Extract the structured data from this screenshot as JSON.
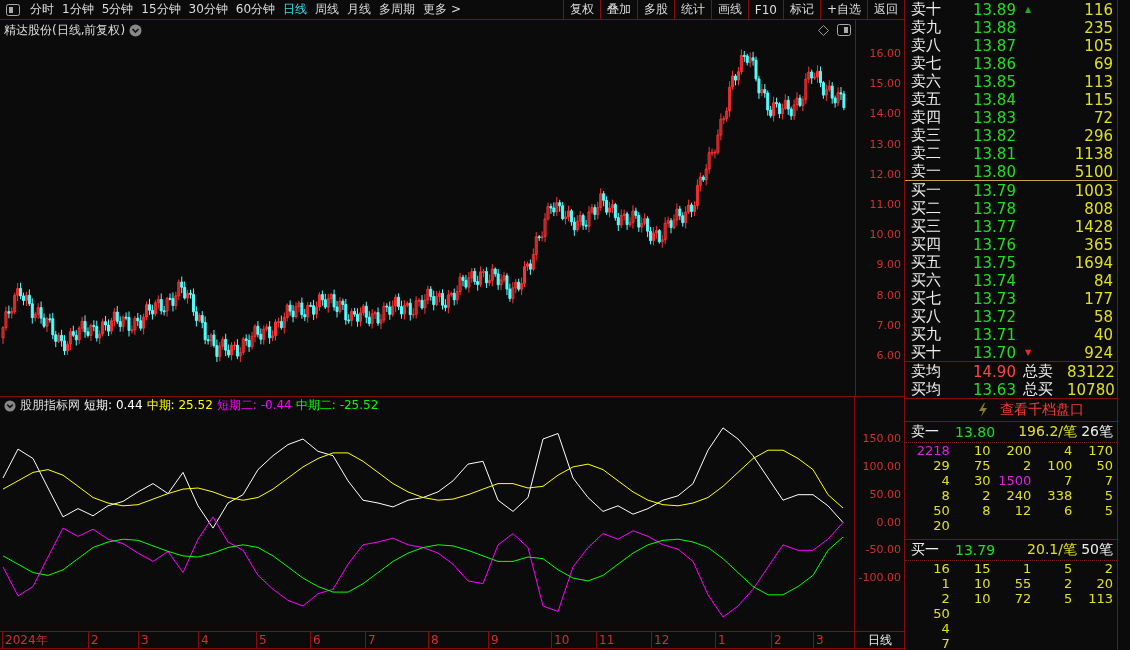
{
  "toolbar": {
    "periods": [
      {
        "label": "分时",
        "selected": false
      },
      {
        "label": "1分钟",
        "selected": false
      },
      {
        "label": "5分钟",
        "selected": false
      },
      {
        "label": "15分钟",
        "selected": false
      },
      {
        "label": "30分钟",
        "selected": false
      },
      {
        "label": "60分钟",
        "selected": false
      },
      {
        "label": "日线",
        "selected": true
      },
      {
        "label": "周线",
        "selected": false
      },
      {
        "label": "月线",
        "selected": false
      },
      {
        "label": "多周期",
        "selected": false
      },
      {
        "label": "更多 >",
        "selected": false
      }
    ],
    "actions": [
      "复权",
      "叠加",
      "多股",
      "统计",
      "画线",
      "F10",
      "标记",
      "+自选",
      "返回"
    ]
  },
  "main_chart": {
    "title": "精达股份(日线,前复权)",
    "price_ticks": [
      "16.00",
      "15.00",
      "14.00",
      "13.00",
      "12.00",
      "11.00",
      "10.00",
      "9.00",
      "8.00",
      "7.00",
      "6.00"
    ]
  },
  "indicator": {
    "name": "股朋指标网",
    "readouts": [
      {
        "label": "短期:",
        "value": "0.44",
        "color": "#ffffff"
      },
      {
        "label": "中期:",
        "value": "25.52",
        "color": "#ffff00"
      },
      {
        "label": "短期二:",
        "value": "-0.44",
        "color": "#ff00ff"
      },
      {
        "label": "中期二:",
        "value": "-25.52",
        "color": "#00ff00"
      }
    ],
    "chart_data": {
      "type": "line",
      "ylim": [
        -195,
        195
      ],
      "yticks": [
        {
          "value": 150,
          "label": "150.00"
        },
        {
          "value": 100,
          "label": "100.00"
        },
        {
          "value": 50,
          "label": "50.00"
        },
        {
          "value": 0,
          "label": "0.00"
        },
        {
          "value": -50,
          "label": "-50.00"
        },
        {
          "value": -100,
          "label": "-100.00"
        }
      ],
      "series": [
        {
          "color": "#ffffff",
          "values": [
            80,
            132,
            115,
            62,
            10,
            25,
            12,
            30,
            38,
            55,
            70,
            52,
            90,
            30,
            -10,
            35,
            50,
            95,
            120,
            140,
            150,
            128,
            120,
            75,
            40,
            35,
            28,
            40,
            45,
            55,
            75,
            105,
            110,
            40,
            20,
            45,
            150,
            160,
            80,
            45,
            20,
            30,
            15,
            25,
            40,
            48,
            70,
            130,
            170,
            150,
            120,
            80,
            40,
            50,
            50,
            30,
            0
          ]
        },
        {
          "color": "#ffff00",
          "values": [
            60,
            75,
            90,
            95,
            85,
            65,
            45,
            35,
            30,
            32,
            42,
            52,
            60,
            62,
            55,
            45,
            40,
            45,
            60,
            80,
            100,
            115,
            125,
            125,
            110,
            90,
            70,
            55,
            45,
            40,
            42,
            50,
            60,
            70,
            70,
            62,
            65,
            85,
            100,
            105,
            95,
            75,
            55,
            40,
            32,
            30,
            35,
            45,
            65,
            90,
            115,
            130,
            130,
            115,
            95,
            50,
            26
          ]
        },
        {
          "color": "#ff00ff",
          "values": [
            -80,
            -132,
            -115,
            -62,
            -10,
            -25,
            -12,
            -30,
            -38,
            -55,
            -70,
            -52,
            -90,
            -30,
            10,
            -35,
            -50,
            -95,
            -120,
            -140,
            -150,
            -128,
            -120,
            -75,
            -40,
            -35,
            -28,
            -40,
            -45,
            -55,
            -75,
            -105,
            -110,
            -40,
            -20,
            -45,
            -150,
            -160,
            -80,
            -45,
            -20,
            -30,
            -15,
            -25,
            -40,
            -48,
            -70,
            -130,
            -170,
            -150,
            -120,
            -80,
            -40,
            -50,
            -50,
            -30,
            0
          ]
        },
        {
          "color": "#00ff00",
          "values": [
            -60,
            -75,
            -90,
            -95,
            -85,
            -65,
            -45,
            -35,
            -30,
            -32,
            -42,
            -52,
            -60,
            -62,
            -55,
            -45,
            -40,
            -45,
            -60,
            -80,
            -100,
            -115,
            -125,
            -125,
            -110,
            -90,
            -70,
            -55,
            -45,
            -40,
            -42,
            -50,
            -60,
            -70,
            -70,
            -62,
            -65,
            -85,
            -100,
            -105,
            -95,
            -75,
            -55,
            -40,
            -32,
            -30,
            -35,
            -45,
            -65,
            -90,
            -115,
            -130,
            -130,
            -115,
            -95,
            -50,
            -26
          ]
        }
      ]
    }
  },
  "date_axis": {
    "labels": [
      "2024年",
      "2",
      "3",
      "4",
      "5",
      "6",
      "7",
      "8",
      "9",
      "10",
      "11",
      "12",
      "1",
      "2",
      "3"
    ],
    "period": "日线"
  },
  "order_book": {
    "asks": [
      {
        "label": "卖十",
        "price": "13.89",
        "volume": "116",
        "arrow": "▲"
      },
      {
        "label": "卖九",
        "price": "13.88",
        "volume": "235"
      },
      {
        "label": "卖八",
        "price": "13.87",
        "volume": "105"
      },
      {
        "label": "卖七",
        "price": "13.86",
        "volume": "69"
      },
      {
        "label": "卖六",
        "price": "13.85",
        "volume": "113"
      },
      {
        "label": "卖五",
        "price": "13.84",
        "volume": "115"
      },
      {
        "label": "卖四",
        "price": "13.83",
        "volume": "72"
      },
      {
        "label": "卖三",
        "price": "13.82",
        "volume": "296"
      },
      {
        "label": "卖二",
        "price": "13.81",
        "volume": "1138"
      },
      {
        "label": "卖一",
        "price": "13.80",
        "volume": "5100"
      }
    ],
    "bids": [
      {
        "label": "买一",
        "price": "13.79",
        "volume": "1003"
      },
      {
        "label": "买二",
        "price": "13.78",
        "volume": "808"
      },
      {
        "label": "买三",
        "price": "13.77",
        "volume": "1428"
      },
      {
        "label": "买四",
        "price": "13.76",
        "volume": "365"
      },
      {
        "label": "买五",
        "price": "13.75",
        "volume": "1694"
      },
      {
        "label": "买六",
        "price": "13.74",
        "volume": "84"
      },
      {
        "label": "买七",
        "price": "13.73",
        "volume": "177"
      },
      {
        "label": "买八",
        "price": "13.72",
        "volume": "58"
      },
      {
        "label": "买九",
        "price": "13.71",
        "volume": "40"
      },
      {
        "label": "买十",
        "price": "13.70",
        "volume": "924",
        "arrow": "▼"
      }
    ],
    "summary": [
      {
        "label": "卖均",
        "price": "14.90",
        "color": "#ff4444",
        "total_label": "总卖",
        "total": "83122"
      },
      {
        "label": "买均",
        "price": "13.63",
        "color": "#22dd22",
        "total_label": "总买",
        "total": "10780"
      }
    ],
    "link": "查看千档盘口",
    "queues": [
      {
        "label": "卖一",
        "price": "13.80",
        "avg": "196.2/笔",
        "count": "26笔",
        "rows": [
          [
            {
              "text": "2218",
              "large": true
            },
            {
              "text": "10",
              "large": false
            },
            {
              "text": "200",
              "large": false
            },
            {
              "text": "4",
              "large": false
            },
            {
              "text": "170",
              "large": false
            }
          ],
          [
            {
              "text": "29",
              "large": false
            },
            {
              "text": "75",
              "large": false
            },
            {
              "text": "2",
              "large": false
            },
            {
              "text": "100",
              "large": false
            },
            {
              "text": "50",
              "large": false
            }
          ],
          [
            {
              "text": "4",
              "large": false
            },
            {
              "text": "30",
              "large": false
            },
            {
              "text": "1500",
              "large": true
            },
            {
              "text": "7",
              "large": false
            },
            {
              "text": "7",
              "large": false
            }
          ],
          [
            {
              "text": "8",
              "large": false
            },
            {
              "text": "2",
              "large": false
            },
            {
              "text": "240",
              "large": false
            },
            {
              "text": "338",
              "large": false
            },
            {
              "text": "5",
              "large": false
            }
          ],
          [
            {
              "text": "50",
              "large": false
            },
            {
              "text": "8",
              "large": false
            },
            {
              "text": "12",
              "large": false
            },
            {
              "text": "6",
              "large": false
            },
            {
              "text": "5",
              "large": false
            }
          ],
          [
            {
              "text": "20",
              "large": false
            }
          ]
        ]
      },
      {
        "label": "买一",
        "price": "13.79",
        "avg": "20.1/笔",
        "count": "50笔",
        "rows": [
          [
            {
              "text": "16",
              "large": false
            },
            {
              "text": "15",
              "large": false
            },
            {
              "text": "1",
              "large": false
            },
            {
              "text": "5",
              "large": false
            },
            {
              "text": "2",
              "large": false
            }
          ],
          [
            {
              "text": "1",
              "large": false
            },
            {
              "text": "10",
              "large": false
            },
            {
              "text": "55",
              "large": false
            },
            {
              "text": "2",
              "large": false
            },
            {
              "text": "20",
              "large": false
            }
          ],
          [
            {
              "text": "2",
              "large": false
            },
            {
              "text": "10",
              "large": false
            },
            {
              "text": "72",
              "large": false
            },
            {
              "text": "5",
              "large": false
            },
            {
              "text": "113",
              "large": false
            }
          ],
          [
            {
              "text": "50",
              "large": false
            }
          ],
          [
            {
              "text": "4",
              "large": false
            }
          ],
          [
            {
              "text": "7",
              "large": false
            }
          ]
        ]
      }
    ]
  }
}
